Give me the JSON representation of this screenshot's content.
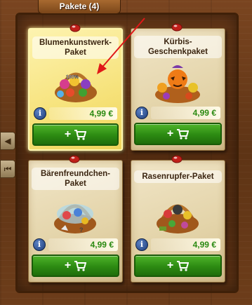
{
  "tab": {
    "label": "Pakete (4)"
  },
  "side": {
    "prev_icon": "triangle-left-icon",
    "first_icon": "skip-first-icon"
  },
  "currency": "€",
  "cards": [
    {
      "title": "Blumenkunstwerk-Paket",
      "price": "4,99 €",
      "badge": "100%",
      "selected": true
    },
    {
      "title": "Kürbis-Geschenkpaket",
      "price": "4,99 €",
      "selected": false
    },
    {
      "title": "Bärenfreundchen-Paket",
      "price": "4,99 €",
      "selected": false
    },
    {
      "title": "Rasenrupfer-Paket",
      "price": "4,99 €",
      "selected": false
    }
  ],
  "buy_icon": "cart-icon",
  "info_label": "i"
}
